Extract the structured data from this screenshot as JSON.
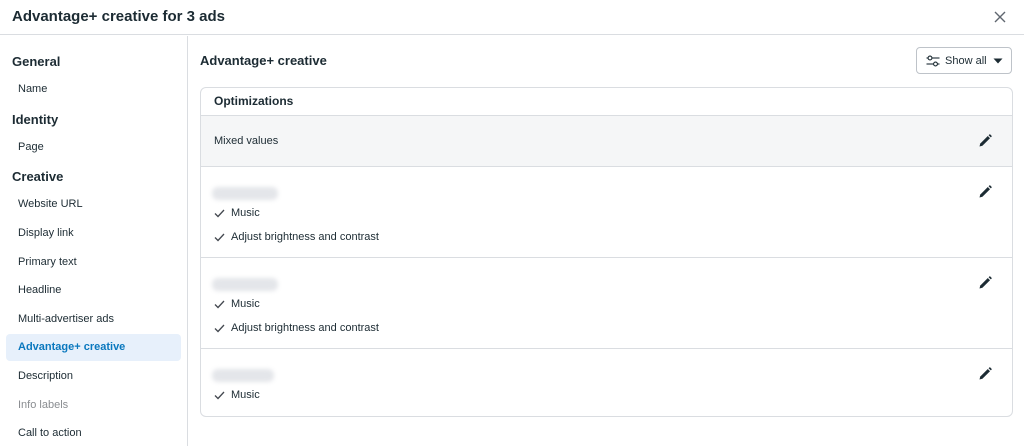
{
  "dialog": {
    "title": "Advantage+ creative for 3 ads"
  },
  "sidebar": {
    "sections": [
      {
        "label": "General",
        "items": [
          {
            "label": "Name"
          }
        ]
      },
      {
        "label": "Identity",
        "items": [
          {
            "label": "Page"
          }
        ]
      },
      {
        "label": "Creative",
        "items": [
          {
            "label": "Website URL"
          },
          {
            "label": "Display link"
          },
          {
            "label": "Primary text"
          },
          {
            "label": "Headline"
          },
          {
            "label": "Multi-advertiser ads"
          },
          {
            "label": "Advantage+ creative",
            "active": true
          },
          {
            "label": "Description"
          },
          {
            "label": "Info labels",
            "disabled": true
          },
          {
            "label": "Call to action"
          }
        ]
      }
    ]
  },
  "main": {
    "title": "Advantage+ creative",
    "show_all_label": "Show all",
    "card": {
      "header": "Optimizations",
      "mixed_values": "Mixed values",
      "ads": [
        {
          "options": [
            "Music",
            "Adjust brightness and contrast"
          ]
        },
        {
          "options": [
            "Music",
            "Adjust brightness and contrast"
          ]
        },
        {
          "options": [
            "Music"
          ]
        }
      ]
    }
  },
  "colors": {
    "accent": "#0a78be",
    "active_bg": "#e7f0fb",
    "border": "#dadde1",
    "row_bg": "#f5f6f7"
  }
}
